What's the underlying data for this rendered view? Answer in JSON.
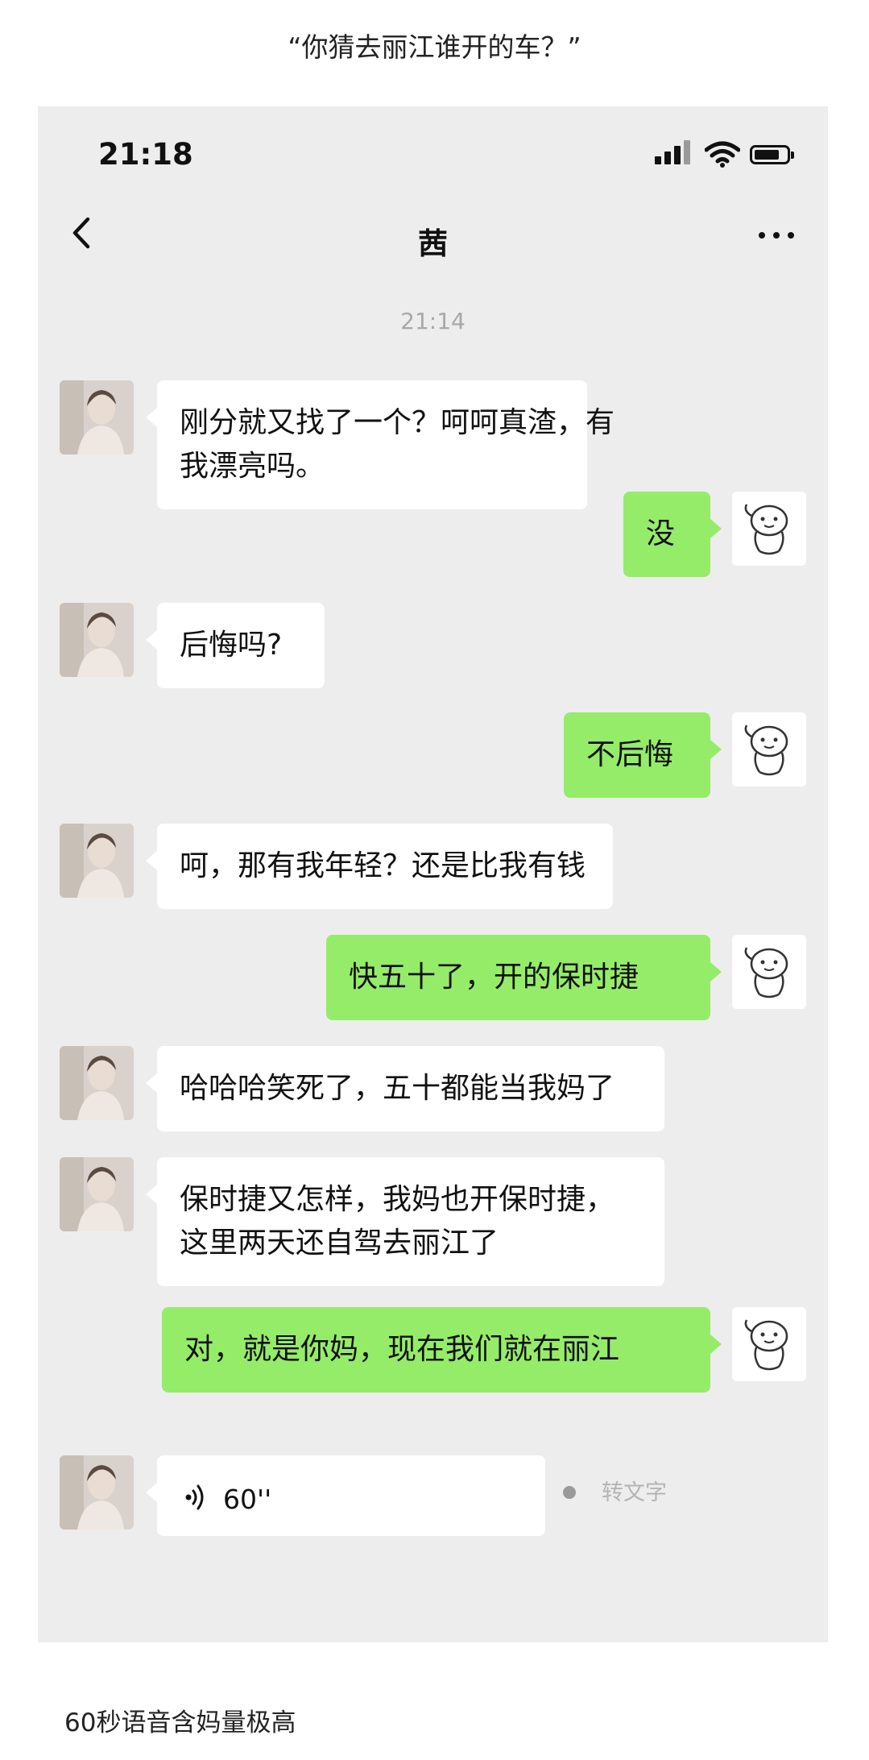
{
  "post": {
    "top_caption": "“你猜去丽江谁开的车？”",
    "bottom_caption": "60秒语音含妈量极高"
  },
  "status_bar": {
    "time": "21:18",
    "icons": [
      "signal-icon",
      "wifi-icon",
      "battery-icon"
    ]
  },
  "nav": {
    "back_icon": "chevron-left-icon",
    "title": "茜",
    "more_icon": "more-dots-icon"
  },
  "chat": {
    "timestamp": "21:14",
    "messages": [
      {
        "side": "left",
        "lines": [
          "刚分就又找了一个？呵呵真渣，有",
          "我漂亮吗。"
        ]
      },
      {
        "side": "right",
        "lines": [
          "没"
        ]
      },
      {
        "side": "left",
        "lines": [
          "后悔吗?"
        ]
      },
      {
        "side": "right",
        "lines": [
          "不后悔"
        ]
      },
      {
        "side": "left",
        "lines": [
          "呵，那有我年轻？还是比我有钱"
        ]
      },
      {
        "side": "right",
        "lines": [
          "快五十了，开的保时捷"
        ]
      },
      {
        "side": "left",
        "lines": [
          "哈哈哈笑死了，五十都能当我妈了"
        ]
      },
      {
        "side": "left",
        "lines": [
          "保时捷又怎样，我妈也开保时捷，",
          "这里两天还自驾去丽江了"
        ]
      },
      {
        "side": "right",
        "lines": [
          "对，就是你妈，现在我们就在丽江"
        ]
      }
    ],
    "voice_message": {
      "duration": "60''",
      "icon": "voice-wave-icon",
      "unread": true,
      "convert_label": "转文字"
    }
  },
  "colors": {
    "chat_background": "#ededed",
    "incoming_bubble": "#ffffff",
    "outgoing_bubble": "#95ec69",
    "timestamp_text": "#a8a8a8"
  }
}
